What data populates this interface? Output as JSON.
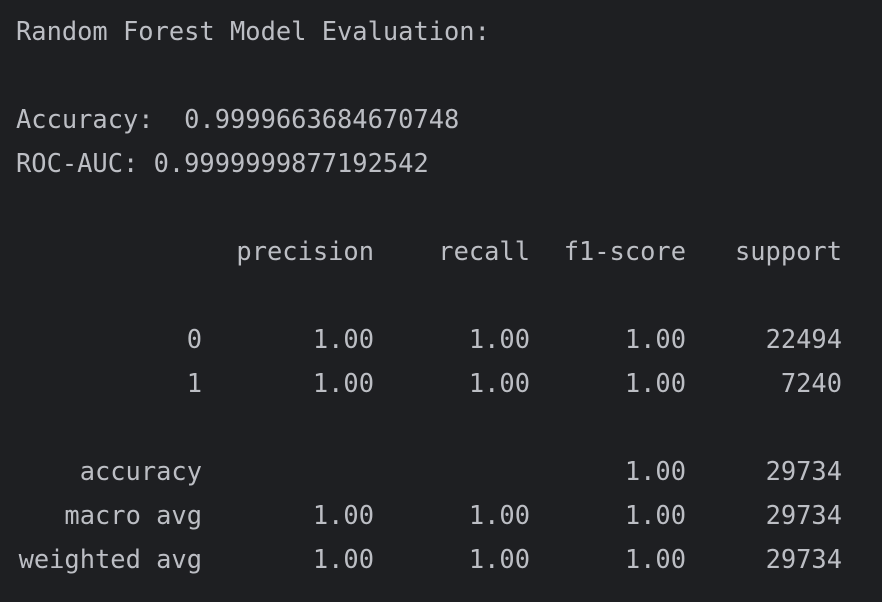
{
  "console": {
    "title": "Random Forest Model Evaluation:",
    "accuracy_line": "Accuracy:  0.9999663684670748",
    "roc_auc_line": "ROC-AUC: 0.9999999877192542"
  },
  "report": {
    "headers": {
      "precision": "precision",
      "recall": "recall",
      "f1": "f1-score",
      "support": "support"
    },
    "rows": [
      {
        "label": "0",
        "precision": "1.00",
        "recall": "1.00",
        "f1": "1.00",
        "support": "22494"
      },
      {
        "label": "1",
        "precision": "1.00",
        "recall": "1.00",
        "f1": "1.00",
        "support": "7240"
      }
    ],
    "summary": [
      {
        "label": "accuracy",
        "precision": "",
        "recall": "",
        "f1": "1.00",
        "support": "29734"
      },
      {
        "label": "macro avg",
        "precision": "1.00",
        "recall": "1.00",
        "f1": "1.00",
        "support": "29734"
      },
      {
        "label": "weighted avg",
        "precision": "1.00",
        "recall": "1.00",
        "f1": "1.00",
        "support": "29734"
      }
    ]
  }
}
